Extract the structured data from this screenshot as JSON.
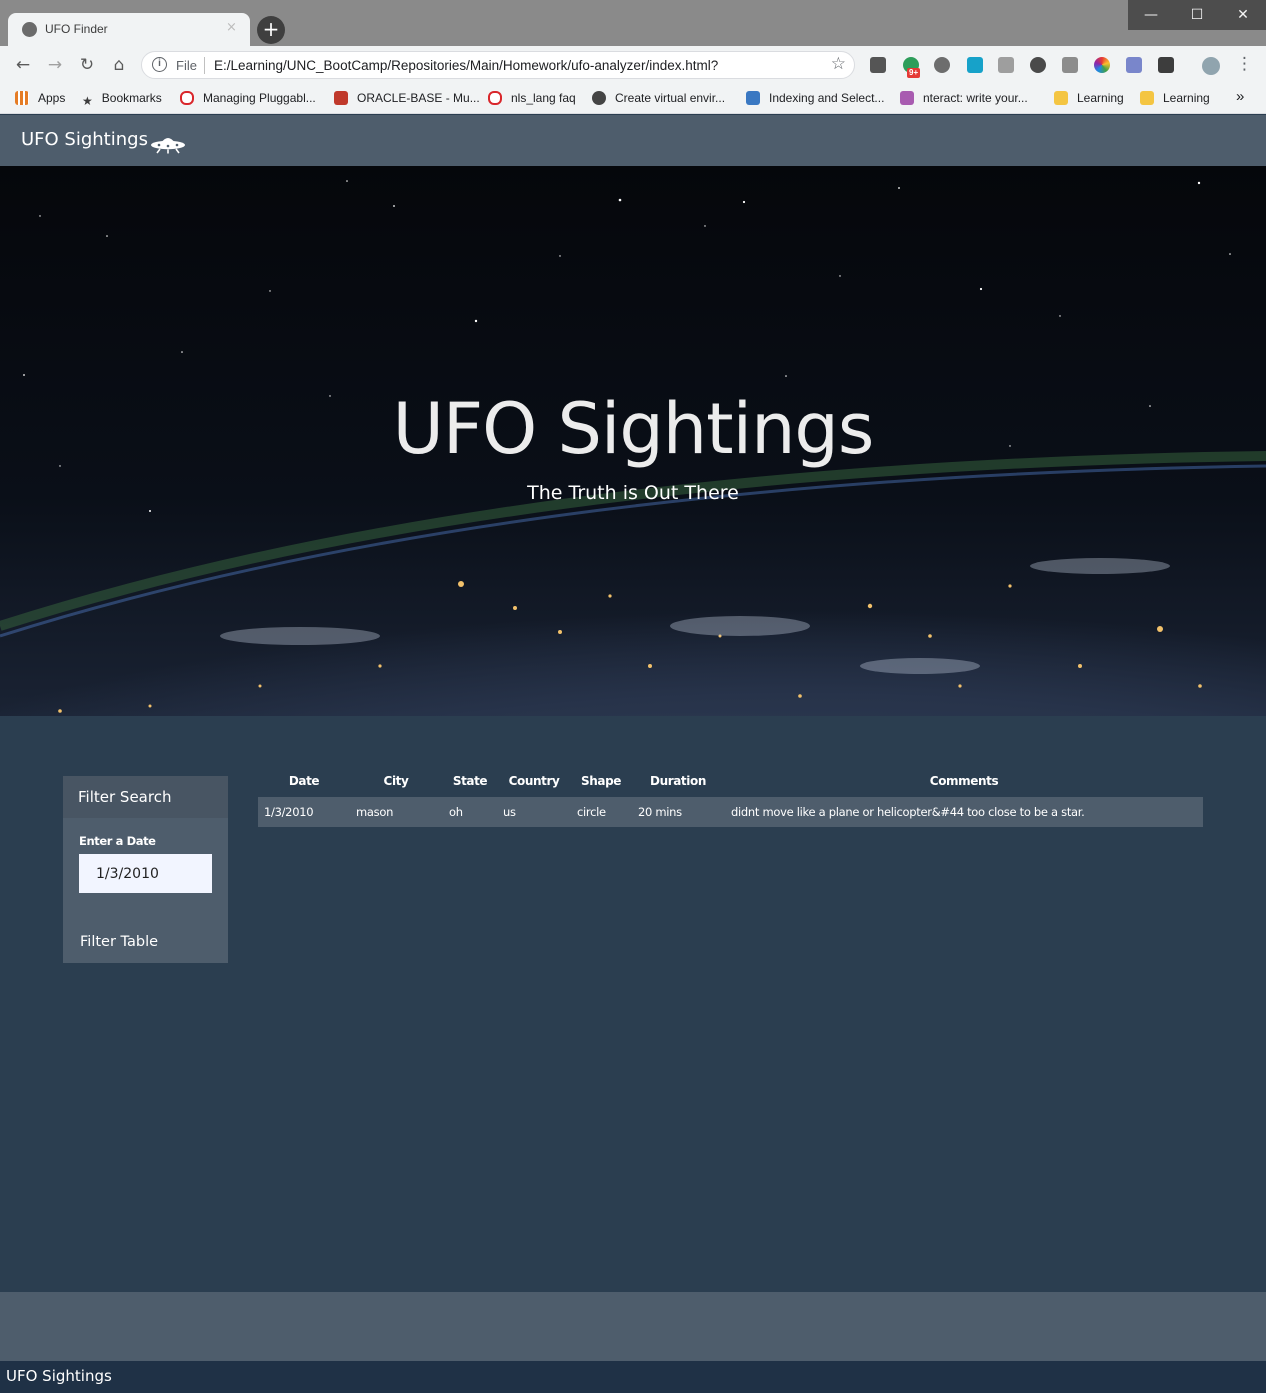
{
  "browser": {
    "tab_title": "UFO Finder",
    "tab_close": "×",
    "new_tab": "+",
    "window_controls": {
      "minimize": "—",
      "maximize": "☐",
      "close": "✕"
    },
    "nav": {
      "back": "←",
      "forward": "→",
      "reload": "↻",
      "home": "⌂"
    },
    "omnibox": {
      "scheme_label": "File",
      "url": "E:/Learning/UNC_BootCamp/Repositories/Main/Homework/ufo-analyzer/index.html?",
      "info": "i",
      "star": "☆"
    },
    "extension_badge": "9+",
    "menu": "⋮",
    "bookmarks": [
      {
        "label": "Apps",
        "color": "#e57c25"
      },
      {
        "label": "Bookmarks",
        "color": "#3c3c3c"
      },
      {
        "label": "Managing Pluggabl...",
        "color": "#d9262b"
      },
      {
        "label": "ORACLE-BASE - Mu...",
        "color": "#c0392b"
      },
      {
        "label": "nls_lang faq",
        "color": "#d9262b"
      },
      {
        "label": "Create virtual envir...",
        "color": "#444444"
      },
      {
        "label": "Indexing and Select...",
        "color": "#3a78c2"
      },
      {
        "label": "nteract: write your...",
        "color": "#a85bb0"
      },
      {
        "label": "Learning",
        "color": "#f4c542"
      },
      {
        "label": "Learning",
        "color": "#f4c542"
      }
    ],
    "bookmarks_more": "»"
  },
  "site": {
    "brand": "UFO Sightings",
    "hero_title": "UFO Sightings",
    "hero_subtitle": "The Truth is Out There",
    "filter": {
      "heading": "Filter Search",
      "date_label": "Enter a Date",
      "date_value": "1/3/2010",
      "button": "Filter Table"
    },
    "table": {
      "headers": [
        "Date",
        "City",
        "State",
        "Country",
        "Shape",
        "Duration",
        "Comments"
      ],
      "rows": [
        [
          "1/3/2010",
          "mason",
          "oh",
          "us",
          "circle",
          "20 mins",
          "didnt move like a plane or helicopter&#44 too close to be a star."
        ]
      ]
    },
    "footer": "UFO Sightings"
  }
}
